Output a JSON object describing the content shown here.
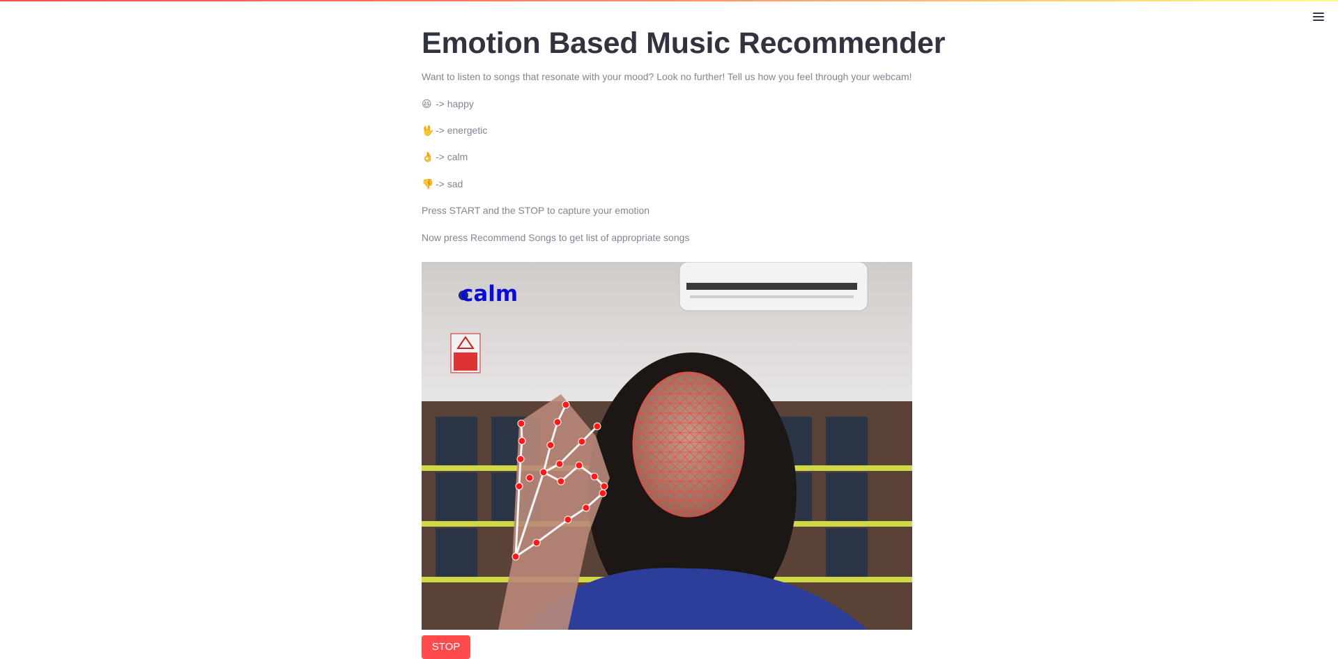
{
  "header": {
    "menu_icon": "hamburger-menu-icon"
  },
  "main": {
    "title": "Emotion Based Music Recommender",
    "intro": "Want to listen to songs that resonate with your mood? Look no further! Tell us how you feel through your webcam!",
    "gestures": [
      {
        "icon": "grinning-face-icon",
        "glyph": "😆",
        "text": "-> happy"
      },
      {
        "icon": "vulcan-salute-icon",
        "glyph": "🖖",
        "text": "-> energetic"
      },
      {
        "icon": "ok-hand-icon",
        "glyph": "👌",
        "text": "-> calm"
      },
      {
        "icon": "thumbs-down-icon",
        "glyph": "👎",
        "text": "-> sad"
      }
    ],
    "instruction_1": "Press START and the STOP to capture your emotion",
    "instruction_2": "Now press Recommend Songs to get list of appropriate songs"
  },
  "webcam": {
    "detected_emotion": "calm",
    "label_color": "#0b0bd6",
    "landmark_color": "#ff1a1a"
  },
  "controls": {
    "stop_label": "STOP",
    "stop_color": "#ff4b4b"
  }
}
